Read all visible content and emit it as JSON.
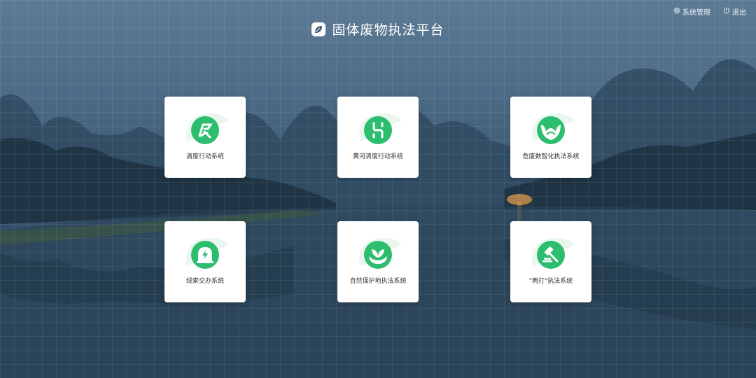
{
  "app": {
    "title": "固体废物执法平台",
    "logo_icon": "leaf-icon"
  },
  "header": {
    "system_manage_label": "系统管理",
    "system_manage_icon": "gear-icon",
    "logout_label": "退出",
    "logout_icon": "power-icon"
  },
  "theme": {
    "accent": "#2dbd6f",
    "card_bg": "#ffffff",
    "text": "#333333"
  },
  "modules": [
    {
      "label": "清废行动系统",
      "icon": "cleanup-action-icon"
    },
    {
      "label": "黄河清废行动系统",
      "icon": "yellow-river-icon"
    },
    {
      "label": "危废数智化执法系统",
      "icon": "hazardous-waste-icon"
    },
    {
      "label": "线索交办系统",
      "icon": "clue-alert-icon"
    },
    {
      "label": "自然保护地执法系统",
      "icon": "nature-reserve-icon"
    },
    {
      "label": "\"两打\"执法系统",
      "icon": "gavel-icon"
    }
  ]
}
